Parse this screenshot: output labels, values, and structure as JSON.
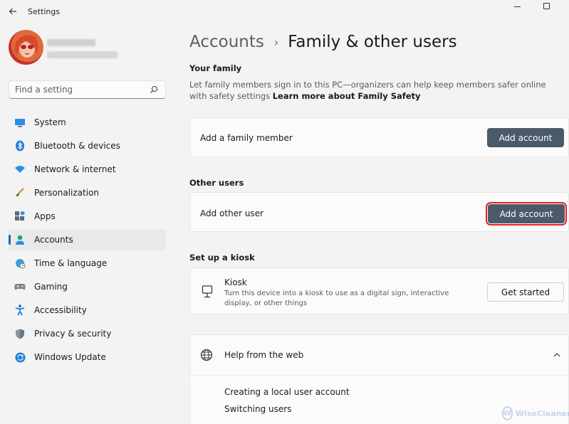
{
  "window": {
    "title": "Settings"
  },
  "search": {
    "placeholder": "Find a setting"
  },
  "nav": {
    "items": [
      {
        "label": "System",
        "icon": "monitor-icon",
        "active": false
      },
      {
        "label": "Bluetooth & devices",
        "icon": "bluetooth-icon",
        "active": false
      },
      {
        "label": "Network & internet",
        "icon": "wifi-icon",
        "active": false
      },
      {
        "label": "Personalization",
        "icon": "brush-icon",
        "active": false
      },
      {
        "label": "Apps",
        "icon": "apps-icon",
        "active": false
      },
      {
        "label": "Accounts",
        "icon": "person-icon",
        "active": true
      },
      {
        "label": "Time & language",
        "icon": "globe-clock-icon",
        "active": false
      },
      {
        "label": "Gaming",
        "icon": "gamepad-icon",
        "active": false
      },
      {
        "label": "Accessibility",
        "icon": "accessibility-icon",
        "active": false
      },
      {
        "label": "Privacy & security",
        "icon": "shield-icon",
        "active": false
      },
      {
        "label": "Windows Update",
        "icon": "update-icon",
        "active": false
      }
    ]
  },
  "breadcrumb": {
    "parent": "Accounts",
    "separator": "›",
    "current": "Family & other users"
  },
  "your_family": {
    "heading": "Your family",
    "description": "Let family members sign in to this PC—organizers can help keep members safer online with safety settings",
    "link": "Learn more about Family Safety",
    "card_label": "Add a family member",
    "button": "Add account"
  },
  "other_users": {
    "heading": "Other users",
    "card_label": "Add other user",
    "button": "Add account"
  },
  "kiosk": {
    "heading": "Set up a kiosk",
    "title": "Kiosk",
    "description": "Turn this device into a kiosk to use as a digital sign, interactive display, or other things",
    "button": "Get started"
  },
  "help": {
    "title": "Help from the web",
    "links": [
      "Creating a local user account",
      "Switching users"
    ]
  },
  "watermark": {
    "text": "WiseCleaner"
  },
  "colors": {
    "accent": "#1565c0",
    "button_dark": "#4a5a68",
    "highlight": "#e0201e"
  }
}
